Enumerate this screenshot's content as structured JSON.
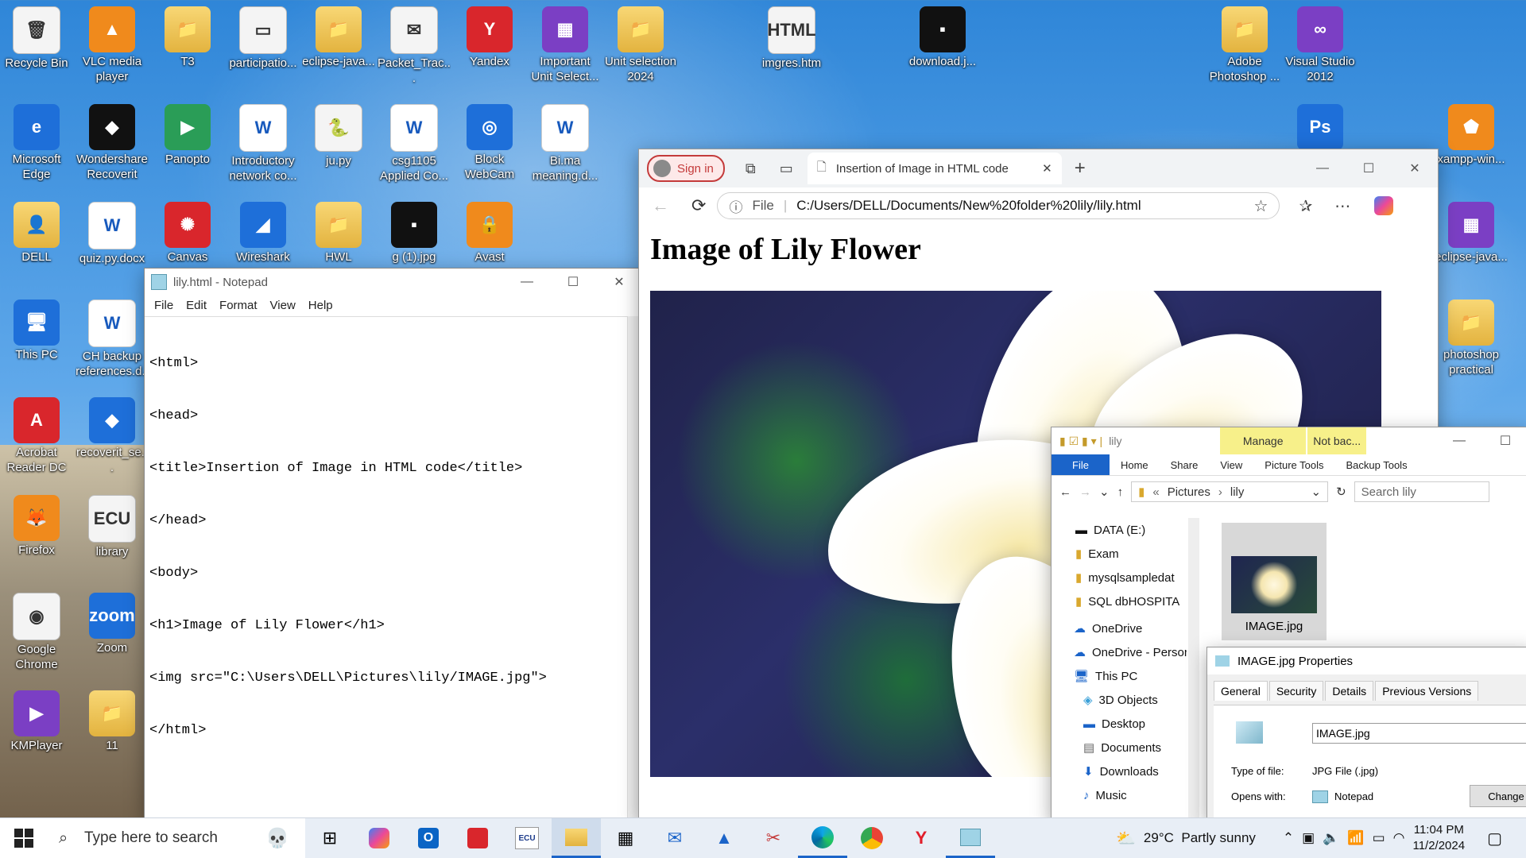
{
  "desktop": {
    "icons": [
      {
        "label": "Recycle Bin",
        "glyph": "🗑"
      },
      {
        "label": "VLC media player",
        "glyph": "▲"
      },
      {
        "label": "T3",
        "glyph": "📁"
      },
      {
        "label": "participatio...",
        "glyph": "▭"
      },
      {
        "label": "eclipse-java...",
        "glyph": "📁"
      },
      {
        "label": "Packet_Trac...",
        "glyph": "✉"
      },
      {
        "label": "Yandex",
        "glyph": "Y"
      },
      {
        "label": "Important Unit Select...",
        "glyph": "▦"
      },
      {
        "label": "Unit selection 2024",
        "glyph": "📁"
      },
      {
        "label": "imgres.htm",
        "glyph": "HTML"
      },
      {
        "label": "download.j...",
        "glyph": "▪"
      },
      {
        "label": "Adobe Photoshop ...",
        "glyph": "📁"
      },
      {
        "label": "Visual Studio 2012",
        "glyph": "∞"
      },
      {
        "label": "Microsoft Edge",
        "glyph": "e"
      },
      {
        "label": "Wondershare Recoverit",
        "glyph": "◆"
      },
      {
        "label": "Panopto",
        "glyph": "▶"
      },
      {
        "label": "Introductory network co...",
        "glyph": "W"
      },
      {
        "label": "ju.py",
        "glyph": "🐍"
      },
      {
        "label": "csg1105 Applied Co...",
        "glyph": "W"
      },
      {
        "label": "Block WebCam",
        "glyph": "◎"
      },
      {
        "label": "Bi.ma meaning.d...",
        "glyph": "W"
      },
      {
        "label": "Ps",
        "glyph": "Ps"
      },
      {
        "label": "xampp-win...",
        "glyph": "⬟"
      },
      {
        "label": "DELL",
        "glyph": "👤"
      },
      {
        "label": "quiz.py.docx",
        "glyph": "W"
      },
      {
        "label": "Canvas",
        "glyph": "✺"
      },
      {
        "label": "Wireshark",
        "glyph": "◢"
      },
      {
        "label": "HWL",
        "glyph": "📁"
      },
      {
        "label": "g (1).jpg",
        "glyph": "▪"
      },
      {
        "label": "Avast",
        "glyph": "🔒"
      },
      {
        "label": "eclipse-java...",
        "glyph": "▦"
      },
      {
        "label": "This PC",
        "glyph": "🖥"
      },
      {
        "label": "CH backup references.d...",
        "glyph": "W"
      },
      {
        "label": "photoshop practical",
        "glyph": "📁"
      },
      {
        "label": "Acrobat Reader DC",
        "glyph": "A"
      },
      {
        "label": "recoverit_se...",
        "glyph": "◆"
      },
      {
        "label": "Firefox",
        "glyph": "🦊"
      },
      {
        "label": "library",
        "glyph": "ECU"
      },
      {
        "label": "Google Chrome",
        "glyph": "◉"
      },
      {
        "label": "Zoom",
        "glyph": "zoom"
      },
      {
        "label": "KMPlayer",
        "glyph": "▶"
      },
      {
        "label": "11",
        "glyph": "📁"
      }
    ]
  },
  "notepad": {
    "title": "lily.html - Notepad",
    "menu": [
      "File",
      "Edit",
      "Format",
      "View",
      "Help"
    ],
    "lines": [
      "<html>",
      "<head>",
      "<title>Insertion of Image in HTML code</title>",
      "</head>",
      "<body>",
      "<h1>Image of Lily Flower</h1>",
      "<img src=\"C:\\Users\\DELL\\Pictures\\lily/IMAGE.jpg\">",
      "</html>"
    ]
  },
  "browser": {
    "signin": "Sign in",
    "tab_title": "Insertion of Image in HTML code",
    "address_prefix": "File",
    "url": "C:/Users/DELL/Documents/New%20folder%20lily/lily.html",
    "heading": "Image of Lily Flower"
  },
  "explorer": {
    "title": "lily",
    "ribbon_top": [
      "Manage",
      "Not bac..."
    ],
    "tabs": [
      "File",
      "Home",
      "Share",
      "View",
      "Picture Tools",
      "Backup Tools"
    ],
    "path": [
      "Pictures",
      "lily"
    ],
    "search_placeholder": "Search lily",
    "tree": [
      {
        "label": "DATA (E:)"
      },
      {
        "label": "Exam"
      },
      {
        "label": "mysqlsampledat"
      },
      {
        "label": "SQL dbHOSPITA"
      },
      {
        "label": "OneDrive"
      },
      {
        "label": "OneDrive - Persor"
      },
      {
        "label": "This PC"
      },
      {
        "label": "3D Objects"
      },
      {
        "label": "Desktop"
      },
      {
        "label": "Documents"
      },
      {
        "label": "Downloads"
      },
      {
        "label": "Music"
      }
    ],
    "file": "IMAGE.jpg"
  },
  "properties": {
    "title": "IMAGE.jpg Properties",
    "tabs": [
      "General",
      "Security",
      "Details",
      "Previous Versions"
    ],
    "filename": "IMAGE.jpg",
    "type_label": "Type of file:",
    "type_value": "JPG File (.jpg)",
    "opens_label": "Opens with:",
    "opens_value": "Notepad",
    "change": "Change"
  },
  "taskbar": {
    "search_placeholder": "Type here to search",
    "weather": "29°C  Partly sunny",
    "time": "11:04 PM",
    "date": "11/2/2024"
  },
  "colors": {
    "accent": "#1b64c9",
    "signin": "#c43b3b",
    "ribbon_manage": "#f7f08a"
  }
}
